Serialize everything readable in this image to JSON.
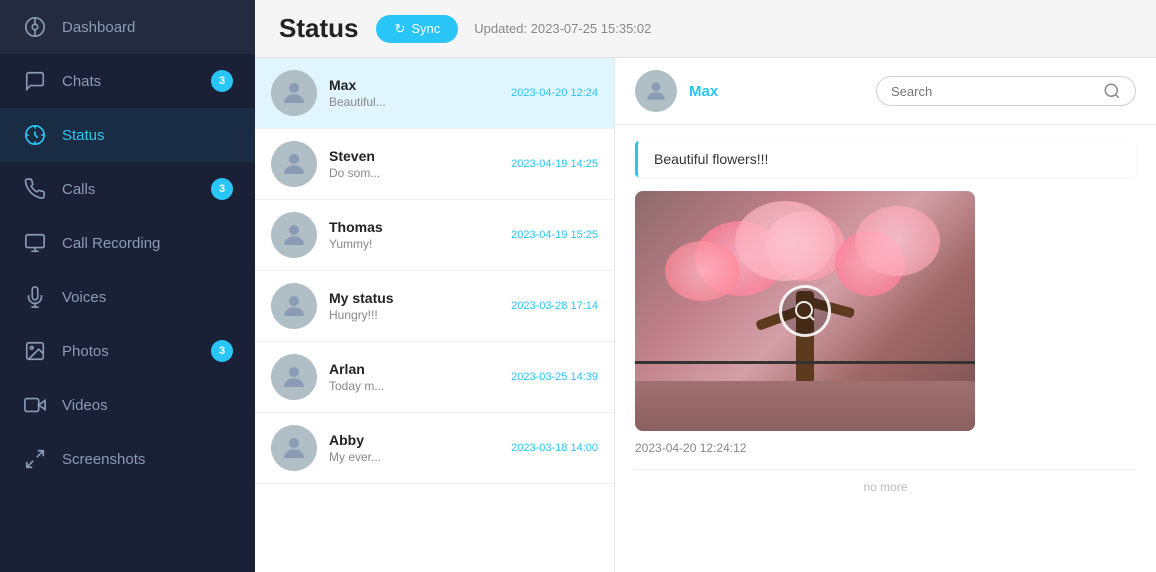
{
  "sidebar": {
    "items": [
      {
        "id": "dashboard",
        "label": "Dashboard",
        "icon": "dashboard-icon",
        "badge": null,
        "active": false
      },
      {
        "id": "chats",
        "label": "Chats",
        "icon": "chats-icon",
        "badge": "3",
        "active": false
      },
      {
        "id": "status",
        "label": "Status",
        "icon": "status-icon",
        "badge": null,
        "active": true
      },
      {
        "id": "calls",
        "label": "Calls",
        "icon": "calls-icon",
        "badge": "3",
        "active": false
      },
      {
        "id": "call-recording",
        "label": "Call Recording",
        "icon": "call-recording-icon",
        "badge": null,
        "active": false
      },
      {
        "id": "voices",
        "label": "Voices",
        "icon": "voices-icon",
        "badge": null,
        "active": false
      },
      {
        "id": "photos",
        "label": "Photos",
        "icon": "photos-icon",
        "badge": "3",
        "active": false
      },
      {
        "id": "videos",
        "label": "Videos",
        "icon": "videos-icon",
        "badge": null,
        "active": false
      },
      {
        "id": "screenshots",
        "label": "Screenshots",
        "icon": "screenshots-icon",
        "badge": null,
        "active": false
      }
    ]
  },
  "header": {
    "title": "Status",
    "sync_label": "Sync",
    "updated_text": "Updated: 2023-07-25 15:35:02"
  },
  "status_list": {
    "items": [
      {
        "id": 1,
        "name": "Max",
        "preview": "Beautiful...",
        "time": "2023-04-20 12:24",
        "selected": true
      },
      {
        "id": 2,
        "name": "Steven",
        "preview": "Do som...",
        "time": "2023-04-19 14:25",
        "selected": false
      },
      {
        "id": 3,
        "name": "Thomas",
        "preview": "Yummy!",
        "time": "2023-04-19 15:25",
        "selected": false
      },
      {
        "id": 4,
        "name": "My status",
        "preview": "Hungry!!!",
        "time": "2023-03-28 17:14",
        "selected": false
      },
      {
        "id": 5,
        "name": "Arlan",
        "preview": "Today m...",
        "time": "2023-03-25 14:39",
        "selected": false
      },
      {
        "id": 6,
        "name": "Abby",
        "preview": "My ever...",
        "time": "2023-03-18 14:00",
        "selected": false
      }
    ]
  },
  "detail": {
    "name": "Max",
    "search_placeholder": "Search",
    "message": "Beautiful flowers!!!",
    "timestamp": "2023-04-20 12:24:12",
    "no_more_label": "no more"
  }
}
